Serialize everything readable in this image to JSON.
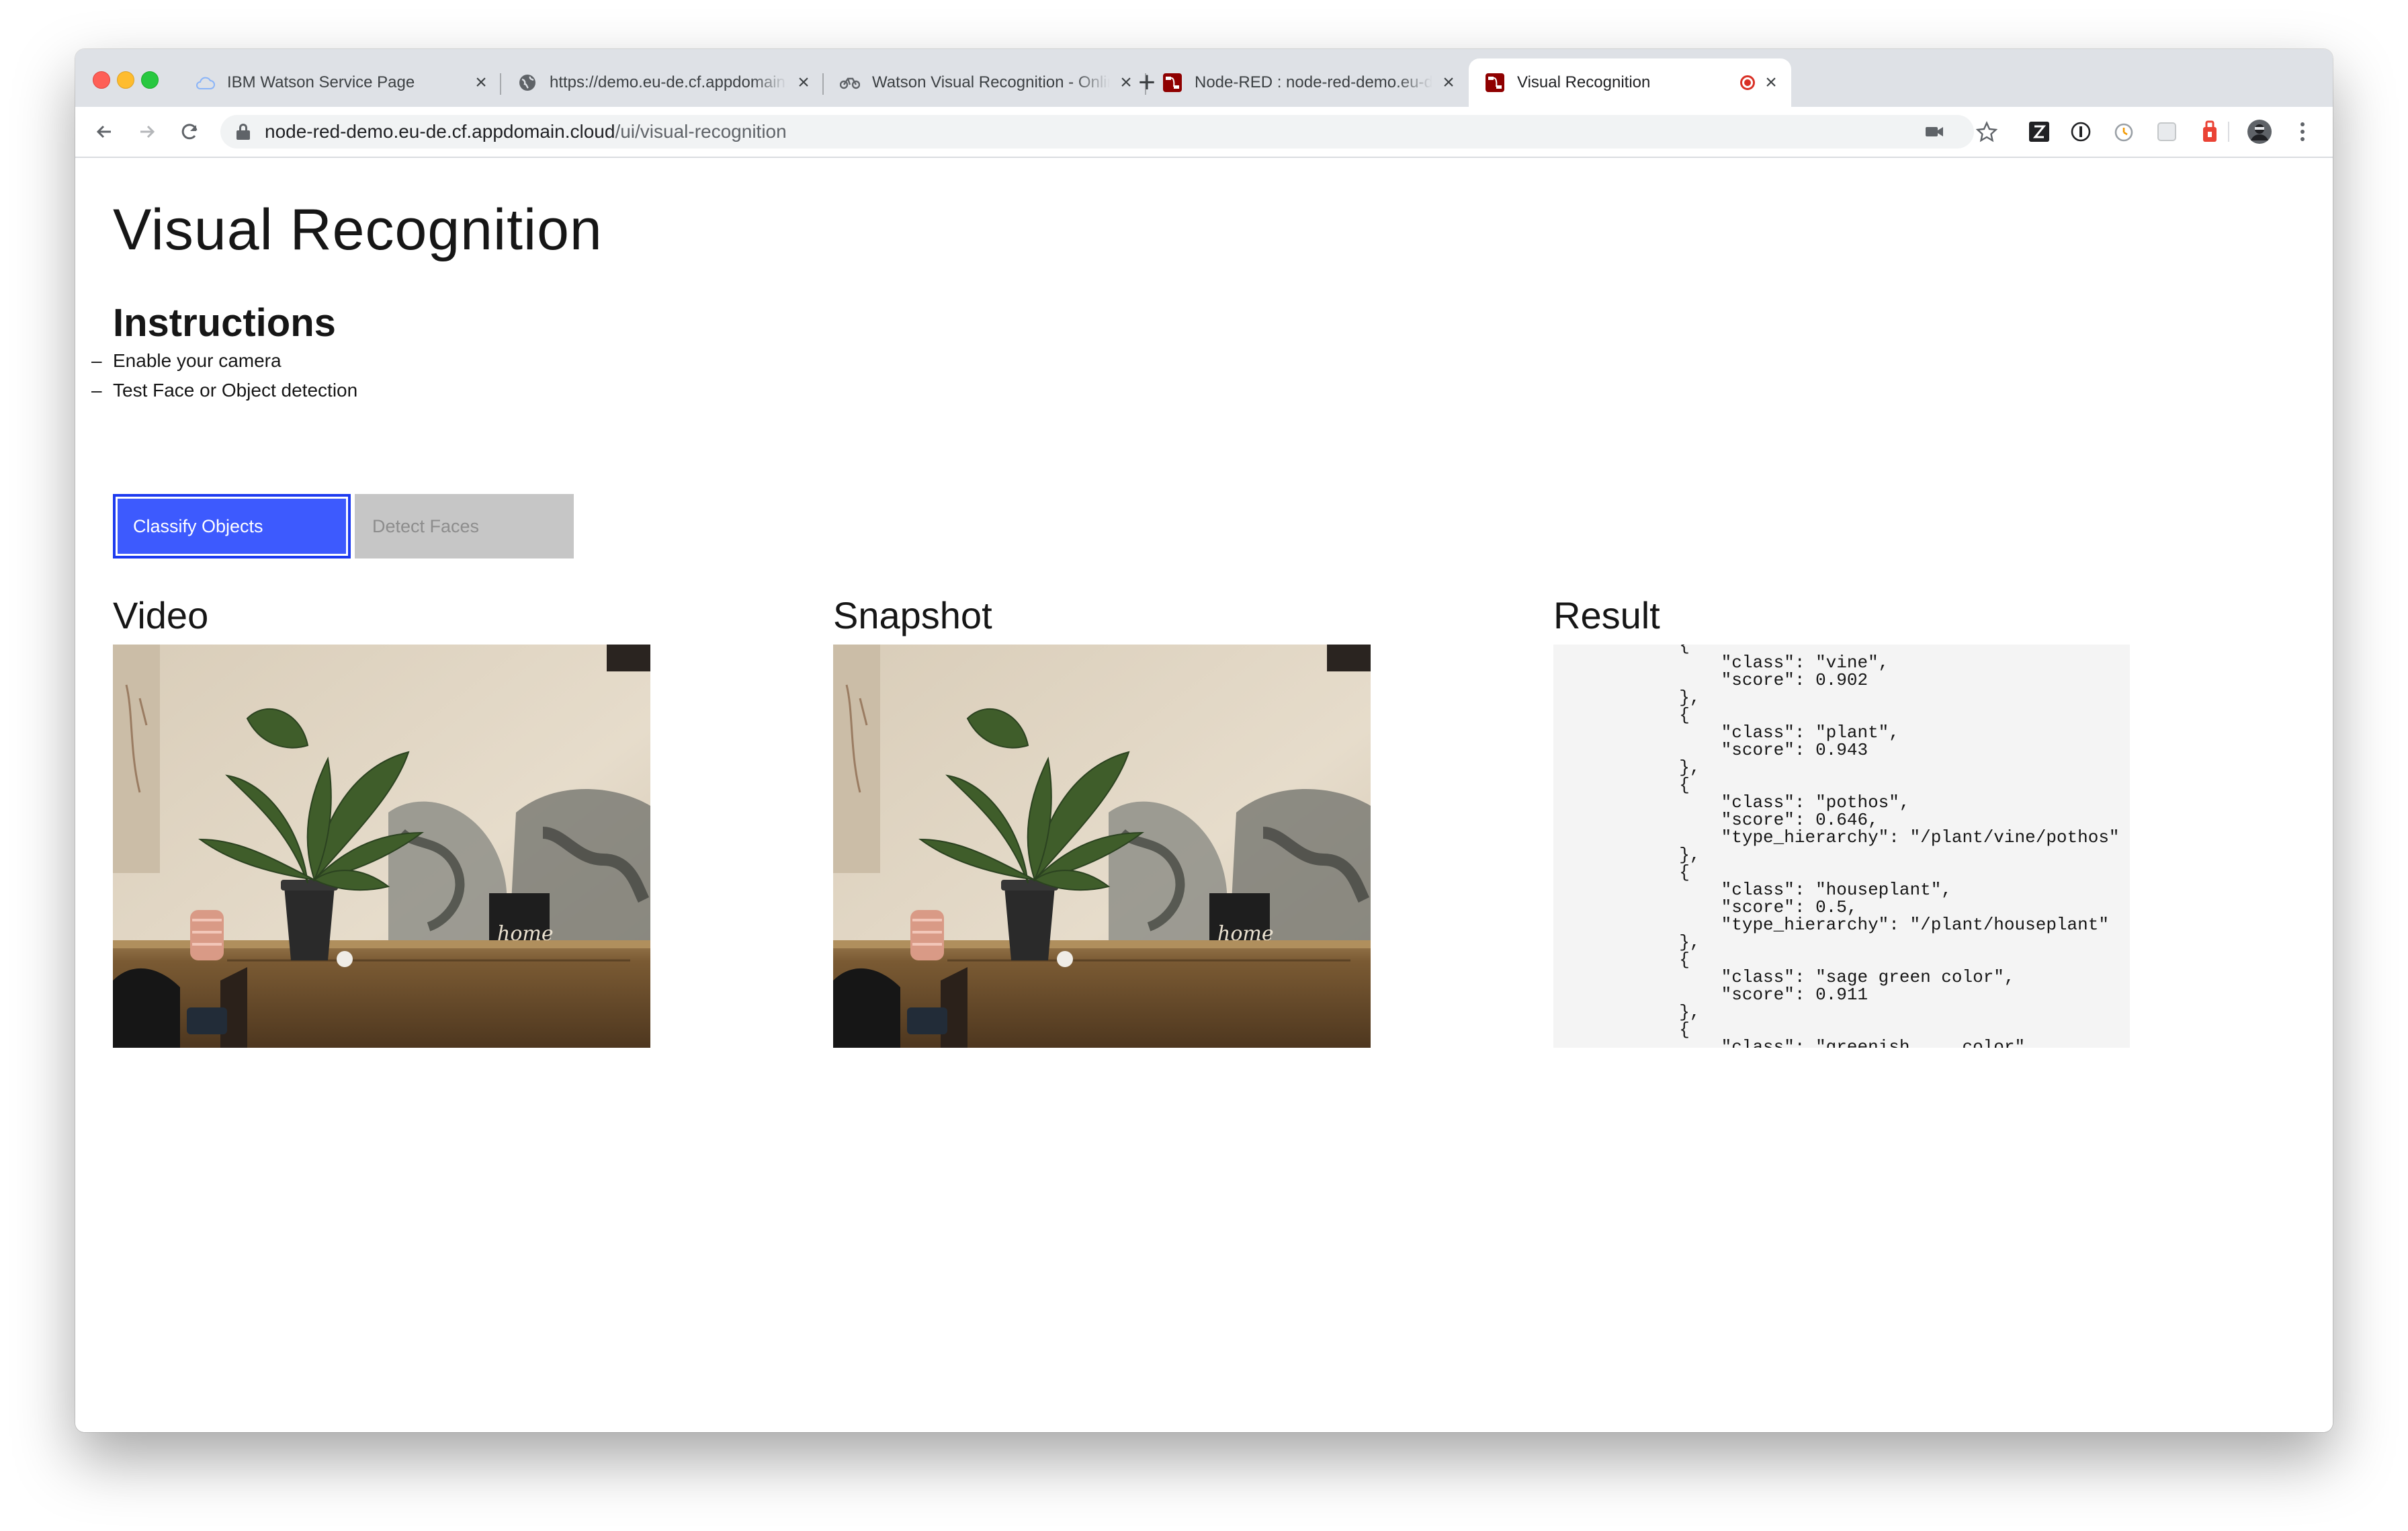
{
  "browser": {
    "tabs": [
      {
        "title": "IBM Watson Service Page",
        "icon": "cloud-icon"
      },
      {
        "title": "https://demo.eu-de.cf.appdomain.cloud",
        "icon": "globe-icon"
      },
      {
        "title": "Watson Visual Recognition - Online Demo",
        "icon": "watson-icon"
      },
      {
        "title": "Node-RED : node-red-demo.eu-de.cf.appdomain.cloud",
        "icon": "node-red-icon"
      },
      {
        "title": "Visual Recognition",
        "icon": "node-red-icon",
        "active": true,
        "recording": true
      }
    ],
    "url_host": "node-red-demo.eu-de.cf.appdomain.cloud",
    "url_path": "/ui/visual-recognition"
  },
  "page": {
    "title": "Visual Recognition",
    "instructions_heading": "Instructions",
    "instructions": [
      "Enable your camera",
      "Test Face or Object detection"
    ],
    "instruction_bullet": "–",
    "buttons": {
      "classify": "Classify Objects",
      "detect": "Detect Faces"
    },
    "sections": {
      "video": "Video",
      "snapshot": "Snapshot",
      "result": "Result"
    },
    "result_text": "            {\n                \"class\": \"vine\",\n                \"score\": 0.902\n            },\n            {\n                \"class\": \"plant\",\n                \"score\": 0.943\n            },\n            {\n                \"class\": \"pothos\",\n                \"score\": 0.646,\n                \"type_hierarchy\": \"/plant/vine/pothos\"\n            },\n            {\n                \"class\": \"houseplant\",\n                \"score\": 0.5,\n                \"type_hierarchy\": \"/plant/houseplant\"\n            },\n            {\n                \"class\": \"sage green color\",\n                \"score\": 0.911\n            },\n            {\n                \"class\": \"greenish ... color\","
  },
  "colors": {
    "primary_button": "#3d5afe",
    "disabled_button": "#c6c6c6",
    "result_background": "#f4f4f4"
  }
}
